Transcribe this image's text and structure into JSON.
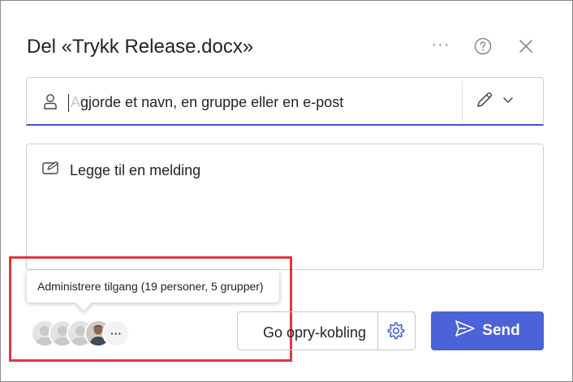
{
  "dialog": {
    "title": "Del «Trykk Release.docx»",
    "header_icons": [
      "more-icon",
      "help-icon",
      "close-icon"
    ],
    "more_label": "···"
  },
  "recipients": {
    "placeholder_first": "A",
    "placeholder_rest": "gjorde et navn, en gruppe eller en e-post",
    "icon": "person-icon",
    "permission_icon": "pencil-icon"
  },
  "message": {
    "placeholder": "Legge til en melding",
    "icon": "compose-icon"
  },
  "access": {
    "tooltip": "Administrere tilgang (19 personer, 5 grupper)",
    "more_label": "···"
  },
  "actions": {
    "copy_link_label": "Go opry-kobling",
    "settings_icon": "gear-icon",
    "send_label": "Send",
    "send_icon": "send-icon"
  },
  "colors": {
    "accent": "#4b63d6",
    "highlight": "#e0373d"
  }
}
